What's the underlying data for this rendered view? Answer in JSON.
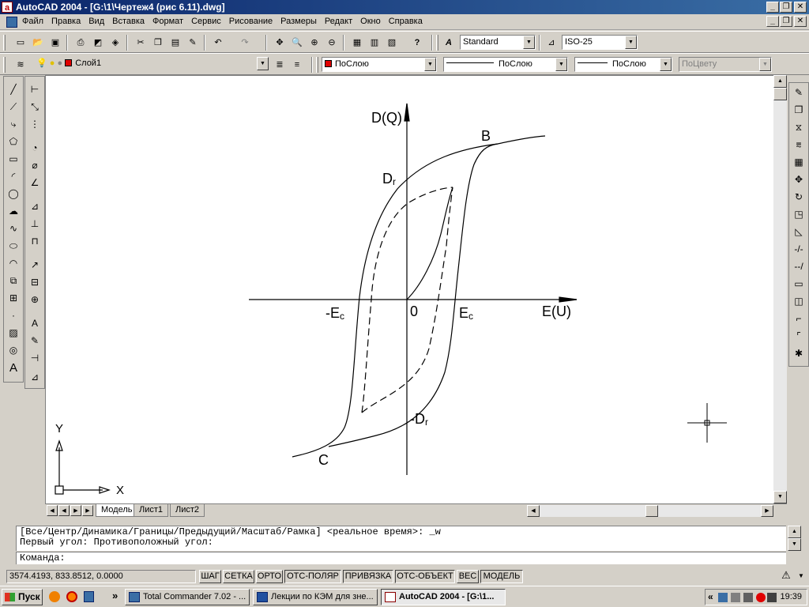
{
  "window": {
    "title": "AutoCAD 2004 - [G:\\1\\Чертеж4 (рис 6.11).dwg]",
    "app_icon": "autocad-icon"
  },
  "menu": [
    "Файл",
    "Правка",
    "Вид",
    "Вставка",
    "Формат",
    "Сервис",
    "Рисование",
    "Размеры",
    "Редакт",
    "Окно",
    "Справка"
  ],
  "caption_buttons": {
    "minimize": "_",
    "maximize": "❐",
    "close": "✕"
  },
  "toolbar_standard": {
    "text_style": "Standard",
    "dim_style": "ISO-25"
  },
  "toolbar_layers": {
    "layer": "Слой1",
    "color": "ПоСлою",
    "linetype": "ПоСлою",
    "lineweight": "ПоСлою",
    "plotstyle": "ПоЦвету",
    "color_swatch": "#e00000"
  },
  "drawing": {
    "labels": {
      "y_axis": "D(Q)",
      "x_axis": "E(U)",
      "point_b": "B",
      "point_c": "C",
      "dr": "D",
      "dr_sub": "r",
      "neg_dr": "-D",
      "neg_dr_sub": "r",
      "ec": "E",
      "ec_sub": "c",
      "neg_ec": "-E",
      "neg_ec_sub": "c",
      "origin": "0"
    },
    "ucs": {
      "x": "X",
      "y": "Y"
    }
  },
  "tabs": [
    "Модель",
    "Лист1",
    "Лист2"
  ],
  "command": {
    "history_line1": "[Все/Центр/Динамика/Границы/Предыдущий/Масштаб/Рамка] <реальное время>: _w",
    "history_line2": "Первый угол: Противоположный угол:",
    "prompt": "Команда:"
  },
  "status": {
    "coords": "3574.4193, 833.8512, 0.0000",
    "toggles": [
      "ШАГ",
      "СЕТКА",
      "ОРТО",
      "ОТС-ПОЛЯР",
      "ПРИВЯЗКА",
      "ОТС-ОБЪЕКТ",
      "ВЕС",
      "МОДЕЛЬ"
    ]
  },
  "taskbar": {
    "start": "Пуск",
    "overflow": "»",
    "tasks": [
      {
        "label": "Total Commander 7.02 - ...",
        "active": false
      },
      {
        "label": "Лекции по КЭМ для зне...",
        "active": false
      },
      {
        "label": "AutoCAD 2004 - [G:\\1...",
        "active": true
      }
    ],
    "clock": "19:39"
  }
}
